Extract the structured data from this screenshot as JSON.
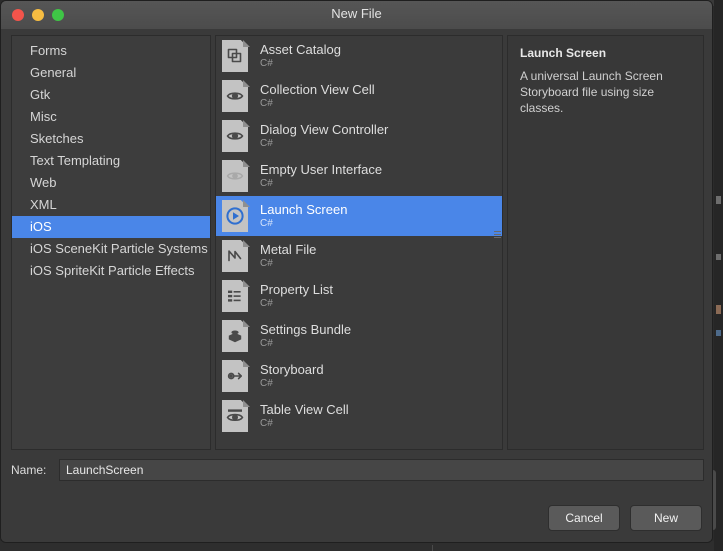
{
  "window": {
    "title": "New File",
    "traffic_lights": [
      {
        "name": "close",
        "color": "#f3544b"
      },
      {
        "name": "minimize",
        "color": "#f7bd42"
      },
      {
        "name": "maximize",
        "color": "#3fc546"
      }
    ]
  },
  "accent_color": "#4a86e8",
  "categories": {
    "items": [
      {
        "label": "Forms",
        "selected": false
      },
      {
        "label": "General",
        "selected": false
      },
      {
        "label": "Gtk",
        "selected": false
      },
      {
        "label": "Misc",
        "selected": false
      },
      {
        "label": "Sketches",
        "selected": false
      },
      {
        "label": "Text Templating",
        "selected": false
      },
      {
        "label": "Web",
        "selected": false
      },
      {
        "label": "XML",
        "selected": false
      },
      {
        "label": "iOS",
        "selected": true
      },
      {
        "label": "iOS SceneKit Particle Systems",
        "selected": false
      },
      {
        "label": "iOS SpriteKit Particle Effects",
        "selected": false
      }
    ]
  },
  "templates": {
    "items": [
      {
        "title": "Asset Catalog",
        "subtitle": "C#",
        "icon": "asset-catalog-icon",
        "selected": false
      },
      {
        "title": "Collection View Cell",
        "subtitle": "C#",
        "icon": "collection-view-cell-icon",
        "selected": false
      },
      {
        "title": "Dialog View Controller",
        "subtitle": "C#",
        "icon": "dialog-view-controller-icon",
        "selected": false
      },
      {
        "title": "Empty User Interface",
        "subtitle": "C#",
        "icon": "empty-user-interface-icon",
        "selected": false
      },
      {
        "title": "Launch Screen",
        "subtitle": "C#",
        "icon": "launch-screen-icon",
        "selected": true
      },
      {
        "title": "Metal File",
        "subtitle": "C#",
        "icon": "metal-file-icon",
        "selected": false
      },
      {
        "title": "Property List",
        "subtitle": "C#",
        "icon": "property-list-icon",
        "selected": false
      },
      {
        "title": "Settings Bundle",
        "subtitle": "C#",
        "icon": "settings-bundle-icon",
        "selected": false
      },
      {
        "title": "Storyboard",
        "subtitle": "C#",
        "icon": "storyboard-icon",
        "selected": false
      },
      {
        "title": "Table View Cell",
        "subtitle": "C#",
        "icon": "table-view-cell-icon",
        "selected": false
      }
    ]
  },
  "preview": {
    "title": "Launch Screen",
    "description": "A universal Launch Screen Storyboard file using size classes."
  },
  "name_field": {
    "label": "Name:",
    "value": "LaunchScreen",
    "placeholder": ""
  },
  "footer": {
    "cancel_label": "Cancel",
    "new_label": "New"
  }
}
